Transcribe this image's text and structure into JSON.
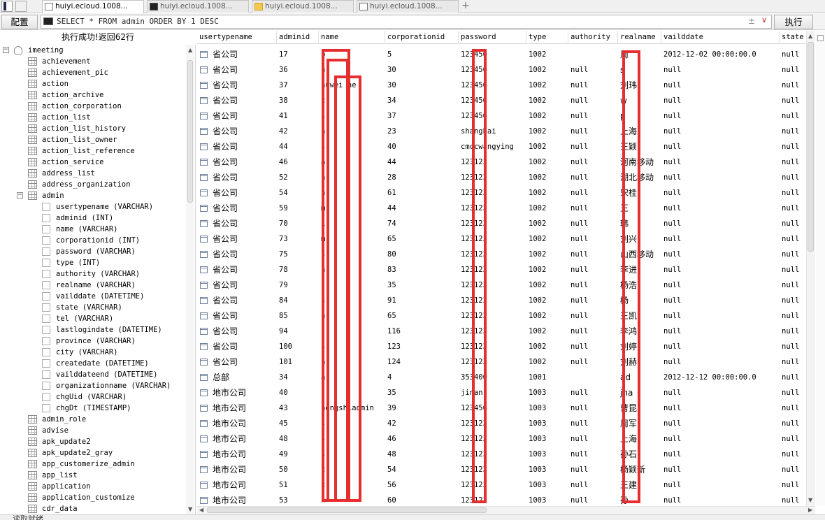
{
  "tabs": [
    {
      "label": "huiyi.ecloud.1008...",
      "icon": "document-icon",
      "active": true
    },
    {
      "label": "huiyi.ecloud.1008...",
      "icon": "terminal-icon",
      "active": false
    },
    {
      "label": "huiyi.ecloud.1008...",
      "icon": "folder-icon",
      "active": false
    },
    {
      "label": "huiyi.ecloud.1008...",
      "icon": "document-icon",
      "active": false
    }
  ],
  "tab_add": "+",
  "toolbar": {
    "config_label": "配置",
    "sql": "SELECT * FROM admin ORDER BY 1 DESC",
    "plusminus": "±",
    "chevron": "∨",
    "run_label": "执行"
  },
  "status": "执行成功!返回62行",
  "tree": [
    {
      "label": "imeeting",
      "icon": "database-icon",
      "level": 0,
      "toggle": "−"
    },
    {
      "label": "achievement",
      "icon": "table-icon",
      "level": 1
    },
    {
      "label": "achievement_pic",
      "icon": "table-icon",
      "level": 1
    },
    {
      "label": "action",
      "icon": "table-icon",
      "level": 1
    },
    {
      "label": "action_archive",
      "icon": "table-icon",
      "level": 1
    },
    {
      "label": "action_corporation",
      "icon": "table-icon",
      "level": 1
    },
    {
      "label": "action_list",
      "icon": "table-icon",
      "level": 1
    },
    {
      "label": "action_list_history",
      "icon": "table-icon",
      "level": 1
    },
    {
      "label": "action_list_owner",
      "icon": "table-icon",
      "level": 1
    },
    {
      "label": "action_list_reference",
      "icon": "table-icon",
      "level": 1
    },
    {
      "label": "action_service",
      "icon": "table-icon",
      "level": 1
    },
    {
      "label": "address_list",
      "icon": "table-icon",
      "level": 1
    },
    {
      "label": "address_organization",
      "icon": "table-icon",
      "level": 1
    },
    {
      "label": "admin",
      "icon": "table-icon",
      "level": 1,
      "toggle": "−"
    },
    {
      "label": "usertypename (VARCHAR)",
      "icon": "column-icon",
      "level": 2
    },
    {
      "label": "adminid (INT)",
      "icon": "column-icon",
      "level": 2
    },
    {
      "label": "name (VARCHAR)",
      "icon": "column-icon",
      "level": 2
    },
    {
      "label": "corporationid (INT)",
      "icon": "column-icon",
      "level": 2
    },
    {
      "label": "password (VARCHAR)",
      "icon": "column-icon",
      "level": 2
    },
    {
      "label": "type (INT)",
      "icon": "column-icon",
      "level": 2
    },
    {
      "label": "authority (VARCHAR)",
      "icon": "column-icon",
      "level": 2
    },
    {
      "label": "realname (VARCHAR)",
      "icon": "column-icon",
      "level": 2
    },
    {
      "label": "vailddate (DATETIME)",
      "icon": "column-icon",
      "level": 2
    },
    {
      "label": "state (VARCHAR)",
      "icon": "column-icon",
      "level": 2
    },
    {
      "label": "tel (VARCHAR)",
      "icon": "column-icon",
      "level": 2
    },
    {
      "label": "lastlogindate (DATETIME)",
      "icon": "column-icon",
      "level": 2
    },
    {
      "label": "province (VARCHAR)",
      "icon": "column-icon",
      "level": 2
    },
    {
      "label": "city (VARCHAR)",
      "icon": "column-icon",
      "level": 2
    },
    {
      "label": "createdate (DATETIME)",
      "icon": "column-icon",
      "level": 2
    },
    {
      "label": "vailddateend (DATETIME)",
      "icon": "column-icon",
      "level": 2
    },
    {
      "label": "organizationname (VARCHAR)",
      "icon": "column-icon",
      "level": 2
    },
    {
      "label": "chgUid (VARCHAR)",
      "icon": "column-icon",
      "level": 2
    },
    {
      "label": "chgDt (TIMESTAMP)",
      "icon": "column-icon",
      "level": 2
    },
    {
      "label": "admin_role",
      "icon": "table-icon",
      "level": 1
    },
    {
      "label": "advise",
      "icon": "table-icon",
      "level": 1
    },
    {
      "label": "apk_update2",
      "icon": "table-icon",
      "level": 1
    },
    {
      "label": "apk_update2_gray",
      "icon": "table-icon",
      "level": 1
    },
    {
      "label": "app_customerize_admin",
      "icon": "table-icon",
      "level": 1
    },
    {
      "label": "app_list",
      "icon": "table-icon",
      "level": 1
    },
    {
      "label": "application",
      "icon": "table-icon",
      "level": 1
    },
    {
      "label": "application_customize",
      "icon": "table-icon",
      "level": 1
    },
    {
      "label": "cdr_data",
      "icon": "table-icon",
      "level": 1
    }
  ],
  "grid": {
    "columns": [
      "usertypename",
      "adminid",
      "name",
      "corporationid",
      "password",
      "type",
      "authority",
      "realname",
      "vailddate",
      "state"
    ],
    "rows": [
      [
        "省公司",
        "17",
        "b",
        "5",
        "123456",
        "1002",
        "",
        "周",
        "2012-12-02 00:00:00.0",
        "null"
      ],
      [
        "省公司",
        "36",
        "h",
        "30",
        "123456",
        "1002",
        "null",
        "s",
        "null",
        "null"
      ],
      [
        "省公司",
        "37",
        "huwei he",
        "30",
        "123456",
        "1002",
        "null",
        "刘玮",
        "null",
        "null"
      ],
      [
        "省公司",
        "38",
        "c",
        "34",
        "123456",
        "1002",
        "null",
        "w",
        "null",
        "null"
      ],
      [
        "省公司",
        "41",
        "s",
        "37",
        "123456",
        "1002",
        "null",
        "p",
        "null",
        "null"
      ],
      [
        "省公司",
        "42",
        "h",
        "23",
        "shanghai",
        "1002",
        "null",
        "上海",
        "null",
        "null"
      ],
      [
        "省公司",
        "44",
        "s",
        "40",
        "cmccwangying",
        "1002",
        "null",
        "王颖",
        "null",
        "null"
      ],
      [
        "省公司",
        "46",
        "a",
        "44",
        "123123",
        "1002",
        "null",
        "河南移动",
        "null",
        "null"
      ],
      [
        "省公司",
        "52",
        "h",
        "28",
        "123123",
        "1002",
        "null",
        "湖北移动",
        "null",
        "null"
      ],
      [
        "省公司",
        "54",
        "h",
        "61",
        "123123",
        "1002",
        "null",
        "宋桂",
        "null",
        "null"
      ],
      [
        "省公司",
        "59",
        "m",
        "44",
        "123123",
        "1002",
        "null",
        "王",
        "null",
        "null"
      ],
      [
        "省公司",
        "70",
        "i",
        "74",
        "123123",
        "1002",
        "null",
        "韩",
        "null",
        "null"
      ],
      [
        "省公司",
        "73",
        "m",
        "65",
        "123123",
        "1002",
        "null",
        "刘兴",
        "null",
        "null"
      ],
      [
        "省公司",
        "75",
        "s",
        "80",
        "123123",
        "1002",
        "null",
        "山西移动",
        "null",
        "null"
      ],
      [
        "省公司",
        "78",
        "h",
        "83",
        "123123",
        "1002",
        "null",
        "李进",
        "null",
        "null"
      ],
      [
        "省公司",
        "79",
        "j",
        "35",
        "123123",
        "1002",
        "null",
        "杨浩",
        "null",
        "null"
      ],
      [
        "省公司",
        "84",
        "s",
        "91",
        "123123",
        "1002",
        "null",
        "杨",
        "null",
        "null"
      ],
      [
        "省公司",
        "85",
        "h",
        "65",
        "123123",
        "1002",
        "null",
        "王凯",
        "null",
        "null"
      ],
      [
        "省公司",
        "94",
        "j",
        "116",
        "123123",
        "1002",
        "null",
        "李鸿",
        "null",
        "null"
      ],
      [
        "省公司",
        "100",
        "s",
        "123",
        "123123",
        "1002",
        "null",
        "刘婷",
        "null",
        "null"
      ],
      [
        "省公司",
        "101",
        "h",
        "124",
        "123123",
        "1002",
        "null",
        "刘赫",
        "null",
        "null"
      ],
      [
        "总部",
        "34",
        "a",
        "4",
        "353400",
        "1001",
        "",
        "ad",
        "2012-12-12 00:00:00.0",
        "null"
      ],
      [
        "地市公司",
        "40",
        "j",
        "35",
        "jinan",
        "1003",
        "null",
        "jna",
        "null",
        "null"
      ],
      [
        "地市公司",
        "43",
        "hengshiadmin",
        "39",
        "123456",
        "1003",
        "null",
        "曹昆",
        "null",
        "null"
      ],
      [
        "地市公司",
        "45",
        "s",
        "42",
        "123123",
        "1003",
        "null",
        "周军",
        "null",
        "null"
      ],
      [
        "地市公司",
        "48",
        "s",
        "46",
        "123123",
        "1003",
        "null",
        "上海",
        "null",
        "null"
      ],
      [
        "地市公司",
        "49",
        "s",
        "48",
        "123123",
        "1003",
        "null",
        "孙石",
        "null",
        "null"
      ],
      [
        "地市公司",
        "50",
        "c",
        "54",
        "123123",
        "1003",
        "null",
        "杨颖新",
        "null",
        "null"
      ],
      [
        "地市公司",
        "51",
        "c",
        "56",
        "123123",
        "1003",
        "null",
        "王建",
        "null",
        "null"
      ],
      [
        "地市公司",
        "53",
        "h",
        "60",
        "123123",
        "1003",
        "null",
        "孙",
        "null",
        "null"
      ]
    ]
  },
  "bottom_status": "读取就绪"
}
